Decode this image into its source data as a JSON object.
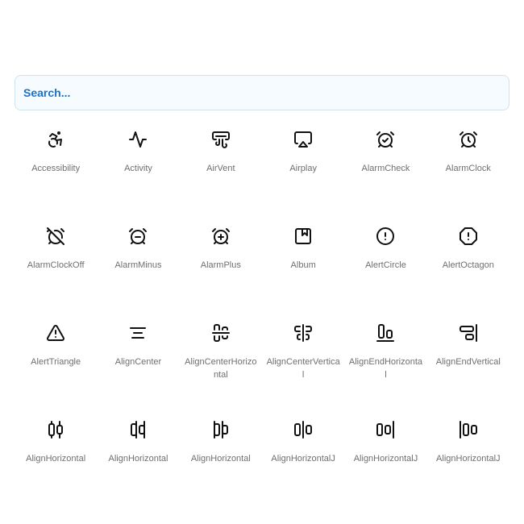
{
  "search": {
    "placeholder": "Search..."
  },
  "icons": [
    {
      "label": "Accessibility",
      "icon": "accessibility-icon"
    },
    {
      "label": "Activity",
      "icon": "activity-icon"
    },
    {
      "label": "AirVent",
      "icon": "air-vent-icon"
    },
    {
      "label": "Airplay",
      "icon": "airplay-icon"
    },
    {
      "label": "AlarmCheck",
      "icon": "alarm-check-icon"
    },
    {
      "label": "AlarmClock",
      "icon": "alarm-clock-icon"
    },
    {
      "label": "AlarmClockOff",
      "icon": "alarm-clock-off-icon"
    },
    {
      "label": "AlarmMinus",
      "icon": "alarm-minus-icon"
    },
    {
      "label": "AlarmPlus",
      "icon": "alarm-plus-icon"
    },
    {
      "label": "Album",
      "icon": "album-icon"
    },
    {
      "label": "AlertCircle",
      "icon": "alert-circle-icon"
    },
    {
      "label": "AlertOctagon",
      "icon": "alert-octagon-icon"
    },
    {
      "label": "AlertTriangle",
      "icon": "alert-triangle-icon"
    },
    {
      "label": "AlignCenter",
      "icon": "align-center-icon"
    },
    {
      "label": "AlignCenterHorizontal",
      "icon": "align-center-horizontal-icon"
    },
    {
      "label": "AlignCenterVertical",
      "icon": "align-center-vertical-icon"
    },
    {
      "label": "AlignEndHorizontal",
      "icon": "align-end-horizontal-icon"
    },
    {
      "label": "AlignEndVertical",
      "icon": "align-end-vertical-icon"
    },
    {
      "label": "AlignHorizontal",
      "icon": "align-horizontal-distribute-center-icon"
    },
    {
      "label": "AlignHorizontal",
      "icon": "align-horizontal-distribute-end-icon"
    },
    {
      "label": "AlignHorizontal",
      "icon": "align-horizontal-distribute-start-icon"
    },
    {
      "label": "AlignHorizontalJ",
      "icon": "align-horizontal-justify-center-icon"
    },
    {
      "label": "AlignHorizontalJ",
      "icon": "align-horizontal-justify-end-icon"
    },
    {
      "label": "AlignHorizontalJ",
      "icon": "align-horizontal-justify-start-icon"
    }
  ]
}
